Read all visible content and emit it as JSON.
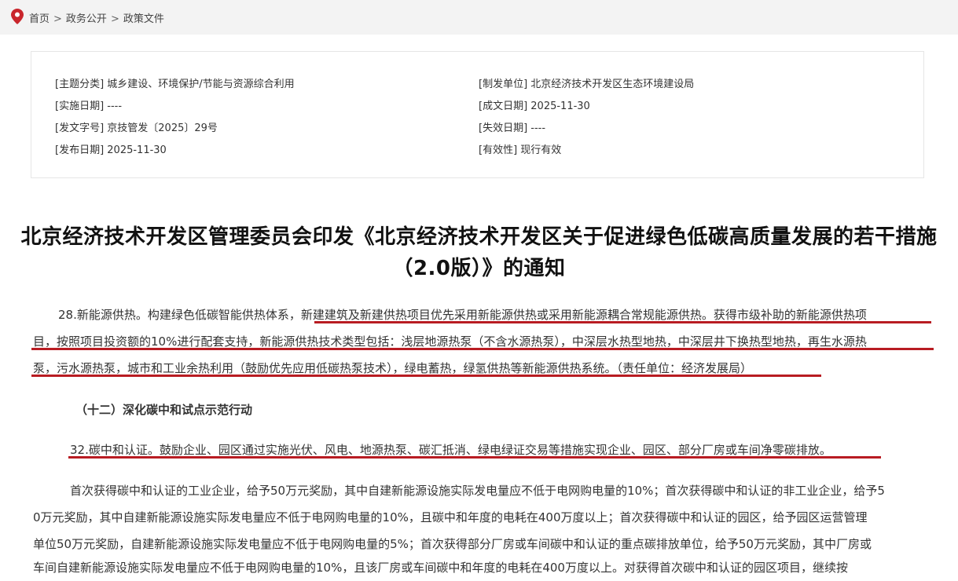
{
  "breadcrumb": {
    "home": "首页",
    "sep": ">",
    "level2": "政务公开",
    "level3": "政策文件"
  },
  "meta": {
    "subject": "[主题分类] 城乡建设、环境保护/节能与资源综合利用",
    "issuer": "[制发单位] 北京经济技术开发区生态环境建设局",
    "effective_date": "[实施日期] ----",
    "written_date": "[成文日期] 2025-11-30",
    "doc_number": "[发文字号] 京技管发〔2025〕29号",
    "expiry_date": "[失效日期] ----",
    "publish_date": "[发布日期] 2025-11-30",
    "validity": "[有效性] 现行有效"
  },
  "article": {
    "title": "北京经济技术开发区管理委员会印发《北京经济技术开发区关于促进绿色低碳高质量发展的若干措施（2.0版）》的通知",
    "p28_line1": "28.新能源供热。构建绿色低碳智能供热体系，新建建筑及新建供热项目优先采用新能源供热或采用新能源耦合常规能源供热。获得市级补助的新能源供热项",
    "p28_line2": "目，按照项目投资额的10%进行配套支持，新能源供热技术类型包括：浅层地源热泵（不含水源热泵），中深层水热型地热，中深层井下换热型地热，再生水源热",
    "p28_line3": "泵，污水源热泵，城市和工业余热利用（鼓励优先应用低碳热泵技术），绿电蓄热，绿氢供热等新能源供热系统。（责任单位：经济发展局）",
    "section12": "（十二）深化碳中和试点示范行动",
    "p32": "32.碳中和认证。鼓励企业、园区通过实施光伏、风电、地源热泵、碳汇抵消、绿电绿证交易等措施实现企业、园区、部分厂房或车间净零碳排放。",
    "award_line1": "首次获得碳中和认证的工业企业，给予50万元奖励，其中自建新能源设施实际发电量应不低于电网购电量的10%；首次获得碳中和认证的非工业企业，给予5",
    "award_line2": "0万元奖励，其中自建新能源设施实际发电量应不低于电网购电量的10%，且碳中和年度的电耗在400万度以上；首次获得碳中和认证的园区，给予园区运营管理",
    "award_line3": "单位50万元奖励，自建新能源设施实际发电量应不低于电网购电量的5%；首次获得部分厂房或车间碳中和认证的重点碳排放单位，给予50万元奖励，其中厂房或",
    "award_line4": "车间自建新能源设施实际发电量应不低于电网购电量的10%，且该厂房或车间碳中和年度的电耗在400万度以上。对获得首次碳中和认证的园区项目，继续按"
  },
  "colors": {
    "underline": "#b81c22",
    "pin": "#c9262c",
    "breadcrumb_bg": "#f3f3f3"
  },
  "icons": {
    "location": "location-pin-icon"
  }
}
